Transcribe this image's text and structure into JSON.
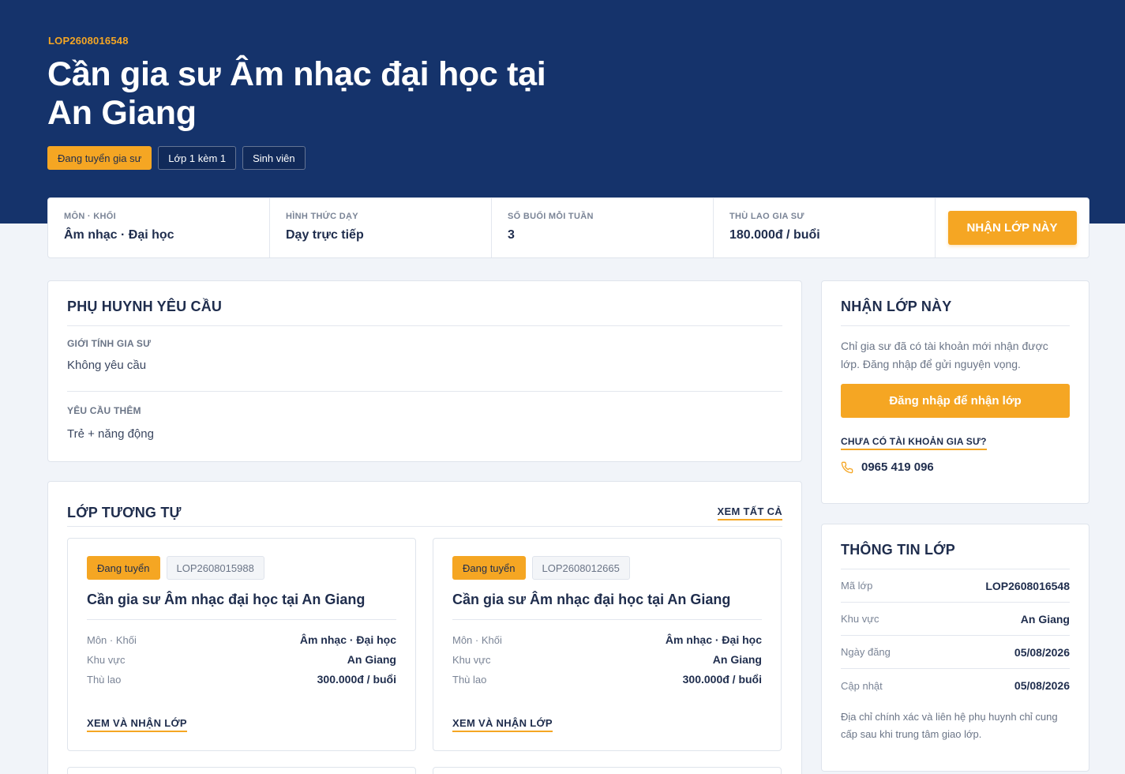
{
  "hero": {
    "code": "LOP2608016548",
    "title": "Cần gia sư Âm nhạc đại học tại An Giang",
    "tags": [
      "Đang tuyển gia sư",
      "Lớp 1 kèm 1",
      "Sinh viên"
    ]
  },
  "summary": {
    "cells": [
      {
        "label": "MÔN · KHỐI",
        "value": "Âm nhạc · Đại học"
      },
      {
        "label": "HÌNH THỨC DẠY",
        "value": "Dạy trực tiếp"
      },
      {
        "label": "SỐ BUỔI MỖI TUẦN",
        "value": "3"
      },
      {
        "label": "THÙ LAO GIA SƯ",
        "value": "180.000đ / buổi"
      }
    ],
    "action_label": "NHẬN LỚP NÀY"
  },
  "requirements": {
    "title": "PHỤ HUYNH YÊU CẦU",
    "fields": [
      {
        "label": "GIỚI TÍNH GIA SƯ",
        "value": "Không yêu cầu"
      },
      {
        "label": "YÊU CẦU THÊM",
        "value": "Trẻ + năng động"
      }
    ]
  },
  "similar": {
    "title": "LỚP TƯƠNG TỰ",
    "view_all": "XEM TẤT CẢ",
    "items": [
      {
        "status": "Đang tuyển",
        "code": "LOP2608015988",
        "title": "Cần gia sư Âm nhạc đại học tại An Giang",
        "rows": [
          {
            "k": "Môn · Khối",
            "v": "Âm nhạc · Đại học"
          },
          {
            "k": "Khu vực",
            "v": "An Giang"
          },
          {
            "k": "Thù lao",
            "v": "300.000đ / buổi"
          }
        ],
        "link": "XEM VÀ NHẬN LỚP"
      },
      {
        "status": "Đang tuyển",
        "code": "LOP2608012665",
        "title": "Cần gia sư Âm nhạc đại học tại An Giang",
        "rows": [
          {
            "k": "Môn · Khối",
            "v": "Âm nhạc · Đại học"
          },
          {
            "k": "Khu vực",
            "v": "An Giang"
          },
          {
            "k": "Thù lao",
            "v": "300.000đ / buổi"
          }
        ],
        "link": "XEM VÀ NHẬN LỚP"
      }
    ]
  },
  "accept_panel": {
    "title": "NHẬN LỚP NÀY",
    "description": "Chỉ gia sư đã có tài khoản mới nhận được lớp. Đăng nhập để gửi nguyện vọng.",
    "login_button": "Đăng nhập để nhận lớp",
    "no_account": "CHƯA CÓ TÀI KHOẢN GIA SƯ?",
    "phone": "0965 419 096",
    "phone_icon": "phone-icon"
  },
  "class_info": {
    "title": "THÔNG TIN LỚP",
    "rows": [
      {
        "k": "Mã lớp",
        "v": "LOP2608016548"
      },
      {
        "k": "Khu vực",
        "v": "An Giang"
      },
      {
        "k": "Ngày đăng",
        "v": "05/08/2026"
      },
      {
        "k": "Cập nhật",
        "v": "05/08/2026"
      }
    ],
    "note": "Địa chỉ chính xác và liên hệ phụ huynh chỉ cung cấp sau khi trung tâm giao lớp."
  },
  "colors": {
    "navy": "#15336b",
    "accent": "#f5a623",
    "background": "#f1f4f9"
  }
}
